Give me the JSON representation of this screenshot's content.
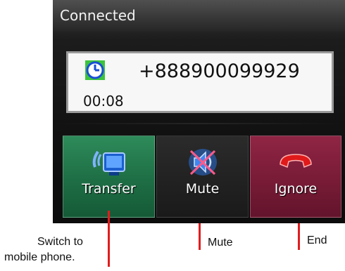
{
  "window": {
    "title": "Connected"
  },
  "call": {
    "number": "+888900099929",
    "duration": "00:08"
  },
  "icons": {
    "clock": "clock-icon",
    "transfer": "phone-transfer-icon",
    "mute": "speaker-muted-icon",
    "ignore": "hang-up-icon"
  },
  "buttons": {
    "transfer": "Transfer",
    "mute": "Mute",
    "ignore": "Ignore"
  },
  "colors": {
    "transfer": "#1f7046",
    "ignore": "#7a1c38",
    "pointer": "#e11d1d"
  },
  "annotations": {
    "transfer_line1": "Switch to",
    "transfer_line2": "mobile phone.",
    "mute": "Mute",
    "end": "End"
  }
}
